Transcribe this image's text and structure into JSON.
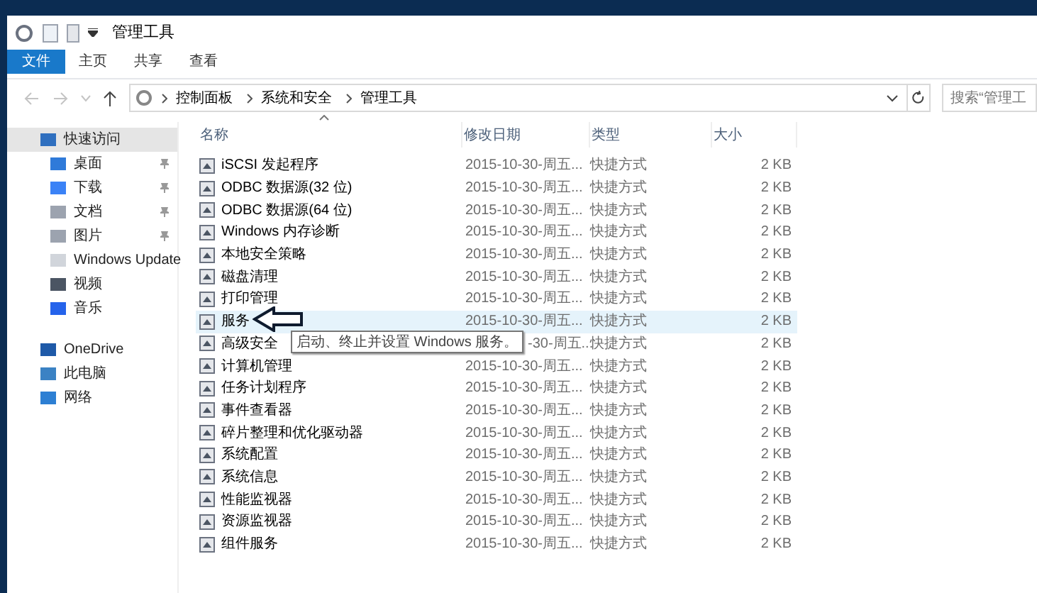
{
  "window": {
    "title": "管理工具"
  },
  "ribbon_tabs": [
    {
      "label": "文件",
      "selected": true
    },
    {
      "label": "主页",
      "selected": false
    },
    {
      "label": "共享",
      "selected": false
    },
    {
      "label": "查看",
      "selected": false
    }
  ],
  "breadcrumb": [
    "控制面板",
    "系统和安全",
    "管理工具"
  ],
  "search": {
    "placeholder": "搜索“管理工"
  },
  "sidebar": {
    "items": [
      {
        "label": "快速访问",
        "selected": true,
        "children": [
          {
            "label": "桌面",
            "selected": false,
            "pinned": true
          },
          {
            "label": "下载",
            "selected": false,
            "pinned": true
          },
          {
            "label": "文档",
            "selected": false,
            "pinned": true
          },
          {
            "label": "图片",
            "selected": false,
            "pinned": true
          },
          {
            "label": "Windows Update",
            "selected": false,
            "pinned": false
          },
          {
            "label": "视频",
            "selected": false,
            "pinned": false
          },
          {
            "label": "音乐",
            "selected": false,
            "pinned": false
          }
        ]
      },
      {
        "label": "OneDrive",
        "selected": false
      },
      {
        "label": "此电脑",
        "selected": false
      },
      {
        "label": "网络",
        "selected": false
      }
    ]
  },
  "table": {
    "columns": [
      "名称",
      "修改日期",
      "类型",
      "大小"
    ],
    "rows": [
      {
        "name": "iSCSI 发起程序",
        "date": "2015-10-30-周五...",
        "type": "快捷方式",
        "size": "2 KB",
        "selected": false,
        "covered": false
      },
      {
        "name": "ODBC 数据源(32 位)",
        "date": "2015-10-30-周五...",
        "type": "快捷方式",
        "size": "2 KB",
        "selected": false,
        "covered": false
      },
      {
        "name": "ODBC 数据源(64 位)",
        "date": "2015-10-30-周五...",
        "type": "快捷方式",
        "size": "2 KB",
        "selected": false,
        "covered": false
      },
      {
        "name": "Windows 内存诊断",
        "date": "2015-10-30-周五...",
        "type": "快捷方式",
        "size": "2 KB",
        "selected": false,
        "covered": false
      },
      {
        "name": "本地安全策略",
        "date": "2015-10-30-周五...",
        "type": "快捷方式",
        "size": "2 KB",
        "selected": false,
        "covered": false
      },
      {
        "name": "磁盘清理",
        "date": "2015-10-30-周五...",
        "type": "快捷方式",
        "size": "2 KB",
        "selected": false,
        "covered": false
      },
      {
        "name": "打印管理",
        "date": "2015-10-30-周五...",
        "type": "快捷方式",
        "size": "2 KB",
        "selected": false,
        "covered": false
      },
      {
        "name": "服务",
        "date": "2015-10-30-周五...",
        "type": "快捷方式",
        "size": "2 KB",
        "selected": true,
        "covered": false
      },
      {
        "name": "高级安全",
        "date": "-30-周五...",
        "type": "快捷方式",
        "size": "2 KB",
        "selected": false,
        "covered": true
      },
      {
        "name": "计算机管理",
        "date": "2015-10-30-周五...",
        "type": "快捷方式",
        "size": "2 KB",
        "selected": false,
        "covered": false
      },
      {
        "name": "任务计划程序",
        "date": "2015-10-30-周五...",
        "type": "快捷方式",
        "size": "2 KB",
        "selected": false,
        "covered": false
      },
      {
        "name": "事件查看器",
        "date": "2015-10-30-周五...",
        "type": "快捷方式",
        "size": "2 KB",
        "selected": false,
        "covered": false
      },
      {
        "name": "碎片整理和优化驱动器",
        "date": "2015-10-30-周五...",
        "type": "快捷方式",
        "size": "2 KB",
        "selected": false,
        "covered": false
      },
      {
        "name": "系统配置",
        "date": "2015-10-30-周五...",
        "type": "快捷方式",
        "size": "2 KB",
        "selected": false,
        "covered": false
      },
      {
        "name": "系统信息",
        "date": "2015-10-30-周五...",
        "type": "快捷方式",
        "size": "2 KB",
        "selected": false,
        "covered": false
      },
      {
        "name": "性能监视器",
        "date": "2015-10-30-周五...",
        "type": "快捷方式",
        "size": "2 KB",
        "selected": false,
        "covered": false
      },
      {
        "name": "资源监视器",
        "date": "2015-10-30-周五...",
        "type": "快捷方式",
        "size": "2 KB",
        "selected": false,
        "covered": false
      },
      {
        "name": "组件服务",
        "date": "2015-10-30-周五...",
        "type": "快捷方式",
        "size": "2 KB",
        "selected": false,
        "covered": false
      }
    ]
  },
  "tooltip": {
    "text": "启动、终止并设置 Windows 服务。"
  }
}
